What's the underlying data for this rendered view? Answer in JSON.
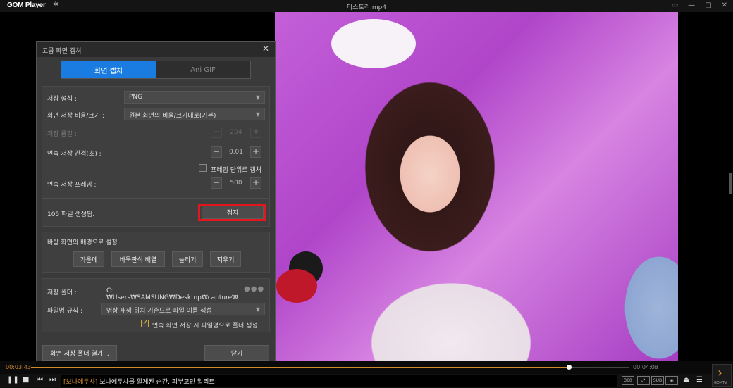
{
  "app": {
    "logo": "GOM Player",
    "window_title": "티스토리.mp4"
  },
  "dialog": {
    "title": "고급 화면 캡처",
    "tabs": [
      {
        "label": "화면 캡처",
        "active": true
      },
      {
        "label": "Ani GIF",
        "active": false
      }
    ],
    "format_label": "저장 형식 :",
    "format_value": "PNG",
    "ratio_label": "화면 저장 비율/크기 :",
    "ratio_value": "원본 화면의 비율/크기대로(기본)",
    "quality_label": "저장 품질 :",
    "quality_value": "204",
    "interval_label": "연속 저장 간격(초) :",
    "interval_value": "0.01",
    "frame_unit_label": "프레임 단위로 캡처",
    "frame_unit_checked": false,
    "frames_label": "연속 저장 프레임 :",
    "frames_value": "500",
    "status_text": "105 파일 생성됨.",
    "stop_label": "정지",
    "wallpaper_header": "바탕 화면의 배경으로 설정",
    "wallpaper_buttons": [
      "가운데",
      "바둑판식 배열",
      "늘리기",
      "지우기"
    ],
    "folder_label": "저장 폴더 :",
    "folder_value": "C:₩Users₩SAMSUNG₩Desktop₩capture₩",
    "naming_label": "파일명 규칙 :",
    "naming_value": "영상 재생 위치 기준으로 파일 이름 생성",
    "folder_by_name_label": "연속 화면 저장 시 파일명으로 폴더 생성",
    "folder_by_name_checked": true,
    "open_folder_label": "화면 저장 폴더 열기...",
    "close_label": "닫기"
  },
  "player": {
    "current_time": "00:03:43",
    "total_time": "00:04:08",
    "progress": 0.9,
    "ticker_tag": "[보나에두사]",
    "ticker_text": "보나에두사를 알게된 순간, 피부고민 일리트!",
    "right_icons": [
      "360-icon",
      "fit-icon",
      "SUB",
      "capture-icon",
      "eject-icon",
      "menu-icon"
    ],
    "gomtv_label": "GOMTV"
  }
}
